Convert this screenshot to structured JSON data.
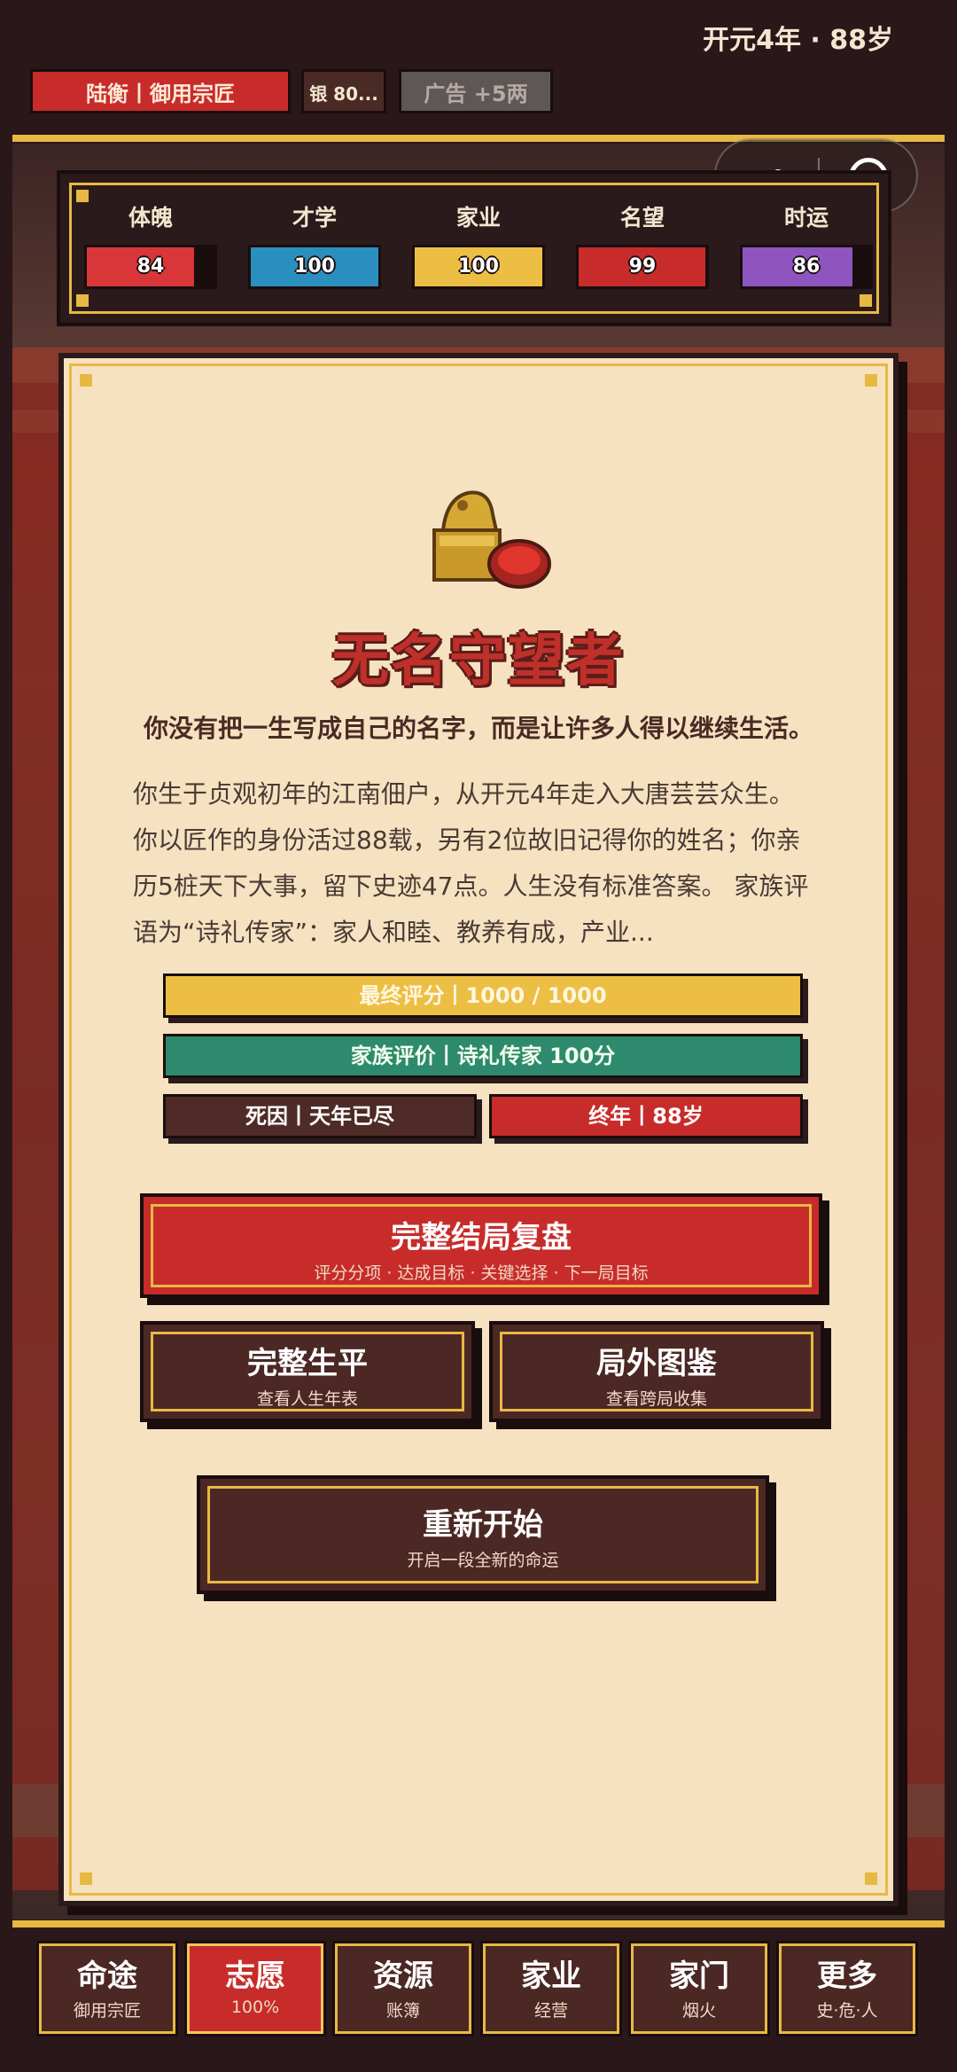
{
  "header": {
    "era": "开元4年 · 88岁",
    "identity": "陆衡丨御用宗匠",
    "silver": "银 80...",
    "ad": "广告 +5两"
  },
  "stats": [
    {
      "label": "体魄",
      "value": "84",
      "fraction": 0.84,
      "color": "#d9363a"
    },
    {
      "label": "才学",
      "value": "100",
      "fraction": 1.0,
      "color": "#2a8fbf"
    },
    {
      "label": "家业",
      "value": "100",
      "fraction": 1.0,
      "color": "#ecbf44"
    },
    {
      "label": "名望",
      "value": "99",
      "fraction": 0.99,
      "color": "#c72c2a"
    },
    {
      "label": "时运",
      "value": "86",
      "fraction": 0.86,
      "color": "#8e55c0"
    }
  ],
  "ending": {
    "seal_icon": "jade-seal-icon",
    "title": "无名守望者",
    "subtitle": "你没有把一生写成自己的名字，而是让许多人得以继续生活。",
    "description_lines": [
      "你生于贞观初年的江南佃户，从开元4年走入大唐芸芸众生。",
      "你以匠作的身份活过88载，另有2位故旧记得你的姓名；你亲",
      "历5桩天下大事，留下史迹47点。人生没有标准答案。 家族评",
      "语为“诗礼传家”：家人和睦、教养有成，产业..."
    ],
    "final_score": "最终评分丨1000 / 1000",
    "family_rating": "家族评价丨诗礼传家 100分",
    "cause_of_death": "死因丨天年已尽",
    "age_at_death": "终年丨88岁"
  },
  "buttons": {
    "review_title": "完整结局复盘",
    "review_sub": "评分分项 · 达成目标 · 关键选择 · 下一局目标",
    "life_title": "完整生平",
    "life_sub": "查看人生年表",
    "gallery_title": "局外图鉴",
    "gallery_sub": "查看跨局收集",
    "restart_title": "重新开始",
    "restart_sub": "开启一段全新的命运"
  },
  "nav": [
    {
      "label": "命途",
      "sub": "御用宗匠",
      "active": false
    },
    {
      "label": "志愿",
      "sub": "100%",
      "active": true
    },
    {
      "label": "资源",
      "sub": "账簿",
      "active": false
    },
    {
      "label": "家业",
      "sub": "经营",
      "active": false
    },
    {
      "label": "家门",
      "sub": "烟火",
      "active": false
    },
    {
      "label": "更多",
      "sub": "史·危·人",
      "active": false
    }
  ],
  "colors": {
    "accent_gold": "#e7b943",
    "accent_red": "#c72c2a",
    "card_bg": "#f6e2c0"
  }
}
